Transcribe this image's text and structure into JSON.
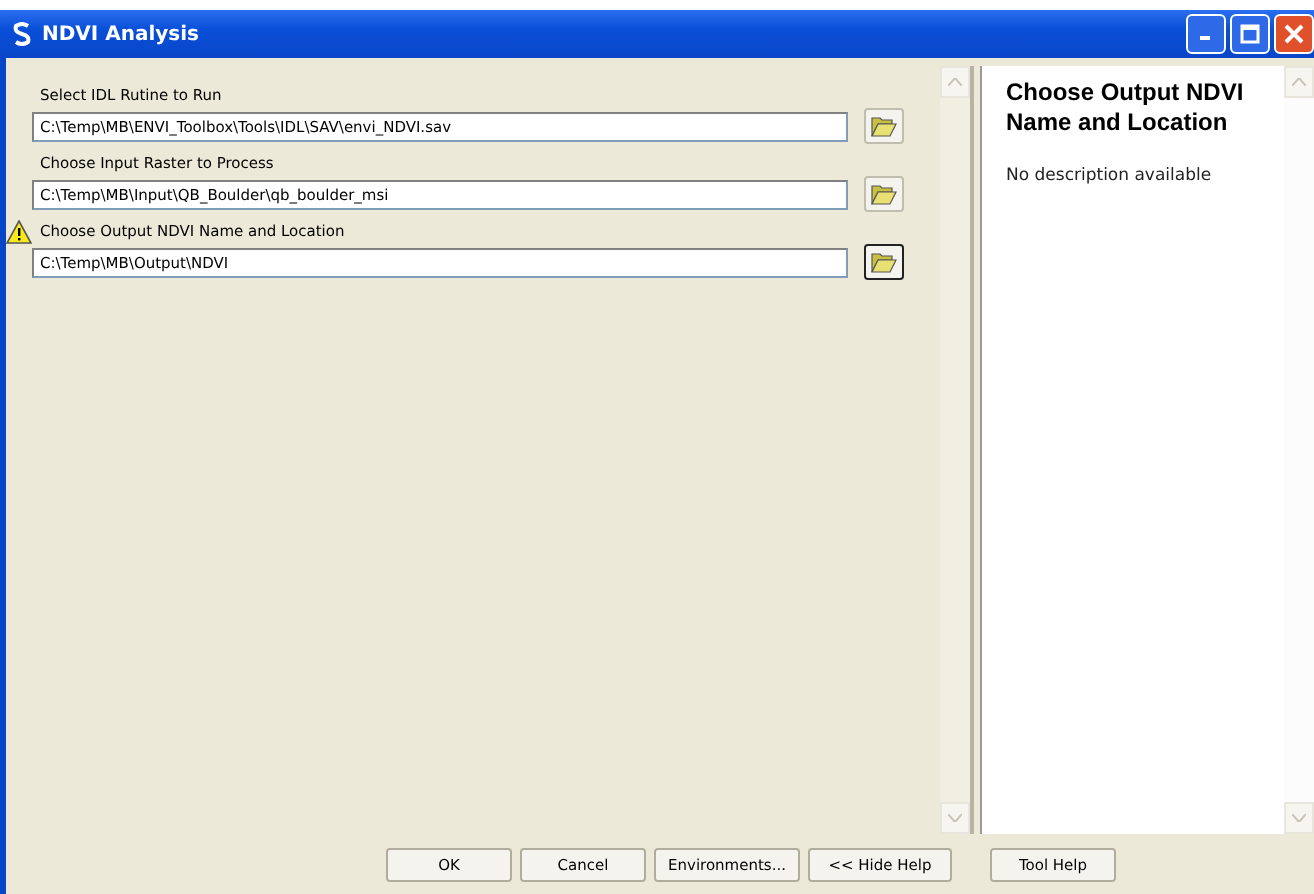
{
  "window": {
    "title": "NDVI Analysis"
  },
  "parameters": [
    {
      "label": "Select IDL Rutine to Run",
      "value": "C:\\Temp\\MB\\ENVI_Toolbox\\Tools\\IDL\\SAV\\envi_NDVI.sav",
      "warning": false,
      "focused": false
    },
    {
      "label": "Choose Input Raster to Process",
      "value": "C:\\Temp\\MB\\Input\\QB_Boulder\\qb_boulder_msi",
      "warning": false,
      "focused": false
    },
    {
      "label": "Choose Output NDVI Name and Location",
      "value": "C:\\Temp\\MB\\Output\\NDVI",
      "warning": true,
      "focused": true
    }
  ],
  "help": {
    "title": "Choose Output NDVI Name and Location",
    "description": "No description available"
  },
  "buttons": [
    "OK",
    "Cancel",
    "Environments...",
    "<< Hide Help"
  ],
  "help_button": "Tool Help"
}
